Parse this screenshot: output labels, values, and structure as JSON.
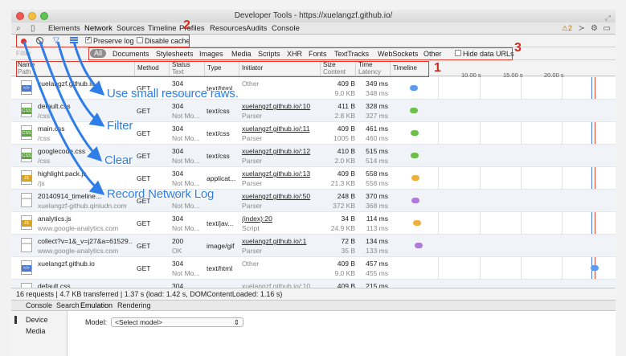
{
  "window": {
    "title": "Developer Tools - https://xuelangzf.github.io/"
  },
  "devtools_tabs": [
    "Elements",
    "Network",
    "Sources",
    "Timeline",
    "Profiles",
    "Resources",
    "Audits",
    "Console"
  ],
  "active_tab": "Network",
  "warnings_count": "2",
  "network_toolbar": {
    "preserve_log_label": "Preserve log",
    "preserve_log_checked": true,
    "disable_cache_label": "Disable cache",
    "disable_cache_checked": false
  },
  "filter": {
    "placeholder": "Filter",
    "types": [
      "All",
      "Documents",
      "Stylesheets",
      "Images",
      "Media",
      "Scripts",
      "XHR",
      "Fonts",
      "TextTracks",
      "WebSockets",
      "Other"
    ],
    "active_type": "All",
    "hide_data_urls_label": "Hide data URLs"
  },
  "columns": [
    {
      "main": "Name",
      "sub": "Path"
    },
    {
      "main": "Method",
      "sub": ""
    },
    {
      "main": "Status",
      "sub": "Text"
    },
    {
      "main": "Type",
      "sub": ""
    },
    {
      "main": "Initiator",
      "sub": ""
    },
    {
      "main": "Size",
      "sub": "Content"
    },
    {
      "main": "Time",
      "sub": "Latency"
    },
    {
      "main": "Timeline",
      "sub": ""
    }
  ],
  "timeline_ticks": [
    "10.00 s",
    "15.00 s",
    "20.00 s"
  ],
  "rows": [
    {
      "name": "xuelangzf.github.io",
      "path": "",
      "filetype": "html",
      "method": "GET",
      "status": "304",
      "status_text": "Not Mo...",
      "type": "text/html",
      "initiator": "Other",
      "initiator_sub": "",
      "size": "409 B",
      "content": "9.0 KB",
      "time": "349 ms",
      "latency": "348 ms",
      "pill_color": "#5b9bf0"
    },
    {
      "name": "default.css",
      "path": "/css",
      "filetype": "css",
      "method": "GET",
      "status": "304",
      "status_text": "Not Mo...",
      "type": "text/css",
      "initiator": "xuelangzf.github.io/:10",
      "initiator_sub": "Parser",
      "size": "411 B",
      "content": "2.8 KB",
      "time": "328 ms",
      "latency": "327 ms",
      "pill_color": "#6cc04a"
    },
    {
      "name": "main.css",
      "path": "/css",
      "filetype": "css",
      "method": "GET",
      "status": "304",
      "status_text": "Not Mo...",
      "type": "text/css",
      "initiator": "xuelangzf.github.io/:11",
      "initiator_sub": "Parser",
      "size": "409 B",
      "content": "1005 B",
      "time": "461 ms",
      "latency": "460 ms",
      "pill_color": "#6cc04a"
    },
    {
      "name": "googlecode.css",
      "path": "/css",
      "filetype": "css",
      "method": "GET",
      "status": "304",
      "status_text": "Not Mo...",
      "type": "text/css",
      "initiator": "xuelangzf.github.io/:12",
      "initiator_sub": "Parser",
      "size": "410 B",
      "content": "2.0 KB",
      "time": "515 ms",
      "latency": "514 ms",
      "pill_color": "#6cc04a"
    },
    {
      "name": "highlight.pack.js",
      "path": "/js",
      "filetype": "js",
      "method": "GET",
      "status": "304",
      "status_text": "Not Mo...",
      "type": "applicat...",
      "initiator": "xuelangzf.github.io/:13",
      "initiator_sub": "Parser",
      "size": "409 B",
      "content": "21.3 KB",
      "time": "558 ms",
      "latency": "556 ms",
      "pill_color": "#f0b040"
    },
    {
      "name": "20140914_timeline...",
      "path": "xuelangzf-github.qiniudn.com",
      "filetype": "img",
      "method": "GET",
      "status": "304",
      "status_text": "Not Mo...",
      "type": "",
      "initiator": "xuelangzf.github.io/:50",
      "initiator_sub": "Parser",
      "size": "248 B",
      "content": "372 KB",
      "time": "370 ms",
      "latency": "368 ms",
      "pill_color": "#b07ad8"
    },
    {
      "name": "analytics.js",
      "path": "www.google-analytics.com",
      "filetype": "js",
      "method": "GET",
      "status": "304",
      "status_text": "Not Mo...",
      "type": "text/jav...",
      "initiator": "(index):20",
      "initiator_sub": "Script",
      "size": "34 B",
      "content": "24.9 KB",
      "time": "114 ms",
      "latency": "113 ms",
      "pill_color": "#f0b040"
    },
    {
      "name": "collect?v=1&_v=j27&a=61529...",
      "path": "www.google-analytics.com",
      "filetype": "img",
      "method": "GET",
      "status": "200",
      "status_text": "OK",
      "type": "image/gif",
      "initiator": "xuelangzf.github.io/:1",
      "initiator_sub": "Parser",
      "size": "72 B",
      "content": "35 B",
      "time": "134 ms",
      "latency": "133 ms",
      "pill_color": "#b07ad8"
    },
    {
      "name": "xuelangzf.github.io",
      "path": "",
      "filetype": "html",
      "method": "GET",
      "status": "304",
      "status_text": "Not Mo...",
      "type": "text/html",
      "initiator": "Other",
      "initiator_sub": "",
      "size": "409 B",
      "content": "9.0 KB",
      "time": "457 ms",
      "latency": "455 ms",
      "pill_color": "#5b9bf0"
    },
    {
      "name": "default.css",
      "path": "",
      "filetype": "css",
      "method": "GET",
      "status": "304",
      "status_text": "",
      "type": "text/css",
      "initiator": "xuelangzf.github.io/:10",
      "initiator_sub": "",
      "size": "409 B",
      "content": "",
      "time": "215 ms",
      "latency": "",
      "pill_color": "#6cc04a"
    }
  ],
  "status_bar": "16 requests | 4.7 KB transferred | 1.37 s (load: 1.42 s, DOMContentLoaded: 1.16 s)",
  "drawer_tabs": [
    "Console",
    "Search",
    "Emulation",
    "Rendering"
  ],
  "active_drawer_tab": "Emulation",
  "drawer": {
    "side_items": [
      "Device",
      "Media"
    ],
    "model_label": "Model:",
    "model_select": "<Select model>"
  },
  "annotations": {
    "numbers": [
      "1",
      "2",
      "3"
    ],
    "notes": [
      "Use small resource raws.",
      "Filter",
      "Clear",
      "Record Network Log"
    ]
  }
}
